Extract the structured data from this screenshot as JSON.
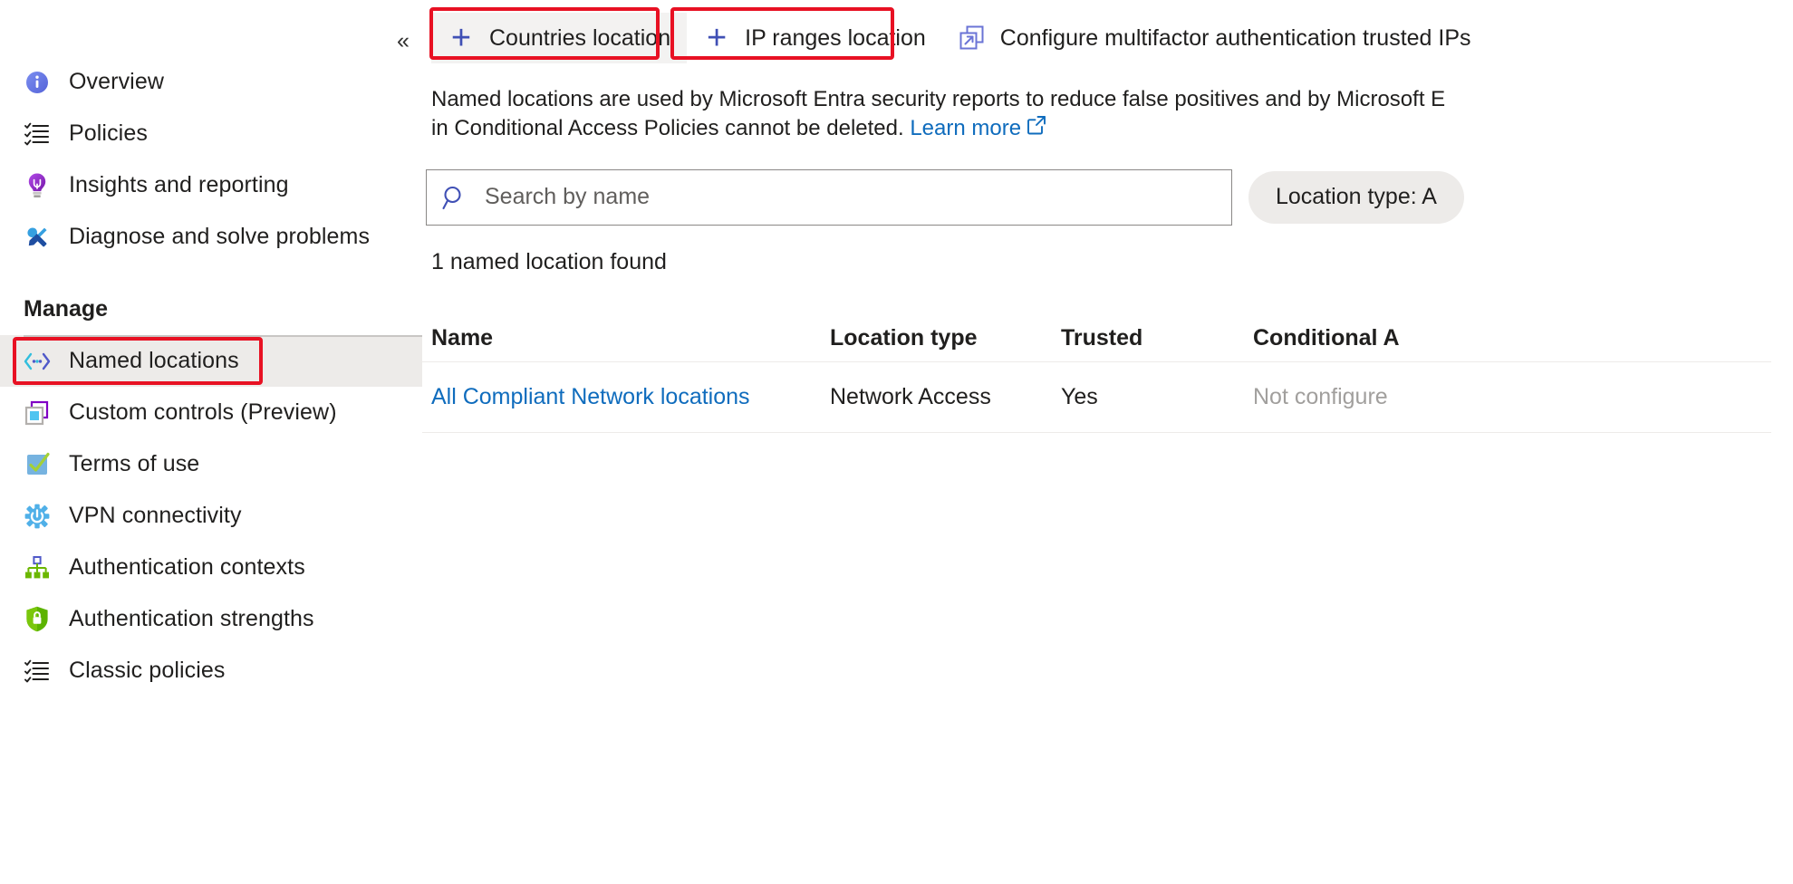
{
  "sidebar": {
    "collapse_label": "«",
    "top_items": [
      {
        "label": "Overview",
        "icon": "info-icon"
      },
      {
        "label": "Policies",
        "icon": "policy-list-icon"
      },
      {
        "label": "Insights and reporting",
        "icon": "lightbulb-icon"
      },
      {
        "label": "Diagnose and solve problems",
        "icon": "tools-icon"
      }
    ],
    "section_label": "Manage",
    "manage_items": [
      {
        "label": "Named locations",
        "icon": "named-locations-icon",
        "selected": true
      },
      {
        "label": "Custom controls (Preview)",
        "icon": "custom-controls-icon",
        "selected": false
      },
      {
        "label": "Terms of use",
        "icon": "terms-check-icon",
        "selected": false
      },
      {
        "label": "VPN connectivity",
        "icon": "vpn-gear-icon",
        "selected": false
      },
      {
        "label": "Authentication contexts",
        "icon": "auth-contexts-icon",
        "selected": false
      },
      {
        "label": "Authentication strengths",
        "icon": "shield-lock-icon",
        "selected": false
      },
      {
        "label": "Classic policies",
        "icon": "policy-list-icon",
        "selected": false
      }
    ]
  },
  "toolbar": {
    "countries_location": "Countries location",
    "ip_ranges_location": "IP ranges location",
    "configure_trusted_ips": "Configure multifactor authentication trusted IPs"
  },
  "description": {
    "line1": "Named locations are used by Microsoft Entra security reports to reduce false positives and by Microsoft E",
    "line2_pre": "in Conditional Access Policies cannot be deleted. ",
    "learn_more": "Learn more"
  },
  "search": {
    "placeholder": "Search by name",
    "value": ""
  },
  "filter": {
    "location_type": "Location type: A"
  },
  "results": {
    "count_text": "1 named location found"
  },
  "table": {
    "headers": [
      "Name",
      "Location type",
      "Trusted",
      "Conditional A"
    ],
    "rows": [
      {
        "name": "All Compliant Network locations",
        "location_type": "Network Access",
        "trusted": "Yes",
        "conditional_access": "Not configure"
      }
    ]
  },
  "colors": {
    "highlight_red": "#e81123",
    "link_blue": "#0f6cbd",
    "accent_indigo": "#4050b5",
    "hover_gray": "#f3f2f1",
    "selected_gray": "#edebe9"
  }
}
